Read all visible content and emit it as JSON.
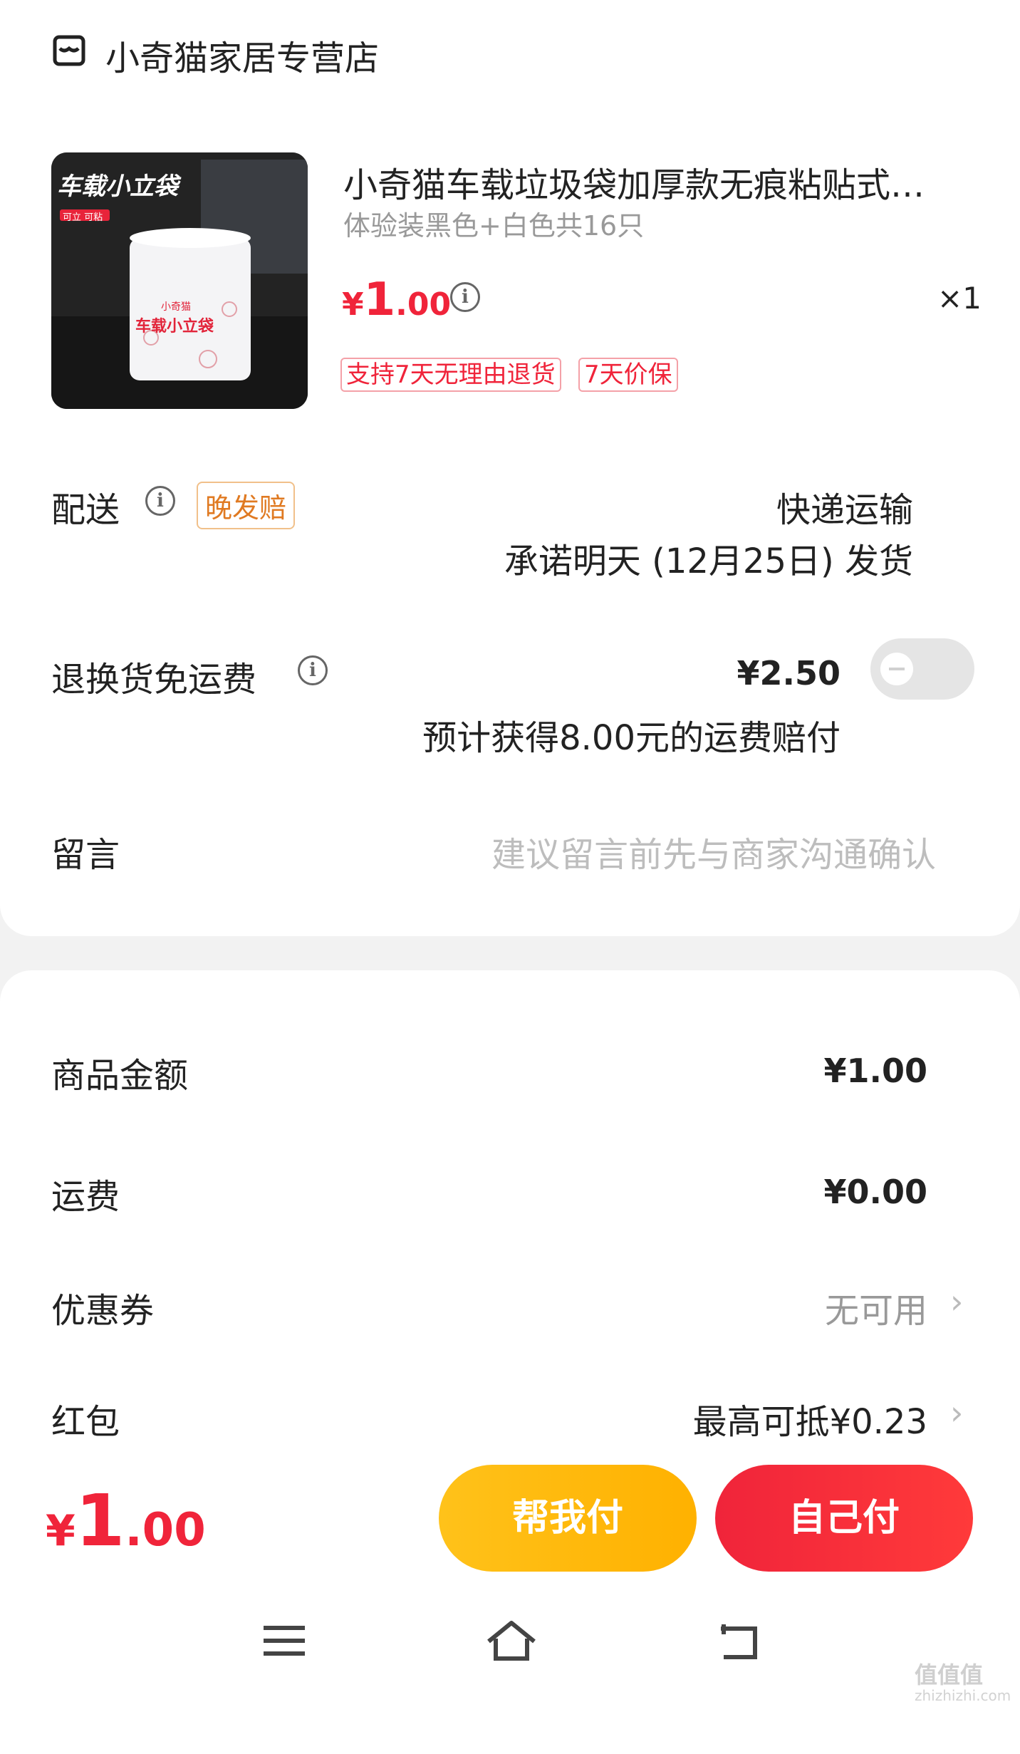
{
  "store": {
    "icon": "store-icon",
    "name": "小奇猫家居专营店"
  },
  "product": {
    "image_caption": "车载小立袋",
    "image_badge": "可立 可粘",
    "image_brand": "小奇猫",
    "image_bag_text": "车载小立袋",
    "title": "小奇猫车载垃圾袋加厚款无痕粘贴式…",
    "spec": "体验装黑色+白色共16只",
    "price_symbol": "¥",
    "price_int": "1",
    "price_dec": ".00",
    "qty": "×1",
    "tags": [
      "支持7天无理由退货",
      "7天价保"
    ]
  },
  "delivery": {
    "label": "配送",
    "badge": "晚发赔",
    "method": "快递运输",
    "promise": "承诺明天 (12月25日) 发货"
  },
  "return_shipping": {
    "label": "退换货免运费",
    "price": "¥2.50",
    "note": "预计获得8.00元的运费赔付",
    "enabled": false
  },
  "message": {
    "label": "留言",
    "placeholder": "建议留言前先与商家沟通确认"
  },
  "summary": {
    "goods_label": "商品金额",
    "goods_value": "¥1.00",
    "freight_label": "运费",
    "freight_value": "¥0.00",
    "coupon_label": "优惠券",
    "coupon_value": "无可用",
    "redpacket_label": "红包",
    "redpacket_value": "最高可抵¥0.23"
  },
  "footer": {
    "total_symbol": "¥",
    "total_int": "1",
    "total_dec": ".00",
    "help_pay": "帮我付",
    "self_pay": "自己付"
  },
  "colors": {
    "accent_red": "#f0243a",
    "accent_yellow": "#ffb800"
  },
  "watermark": {
    "text": "值值值",
    "url": "zhizhizhi.com"
  }
}
